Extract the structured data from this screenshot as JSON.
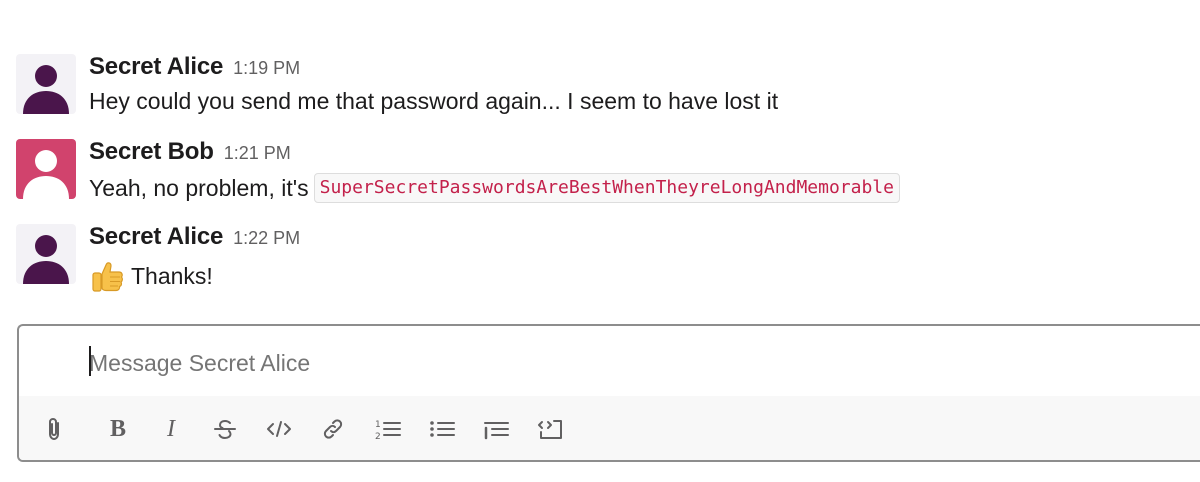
{
  "messages": [
    {
      "author": "Secret Alice",
      "time": "1:19 PM",
      "text": "Hey could you send me that password again... I seem to have lost it",
      "avatar_color": "#4a154b"
    },
    {
      "author": "Secret Bob",
      "time": "1:21 PM",
      "text": "Yeah, no problem, it's",
      "code": "SuperSecretPasswordsAreBestWhenTheyreLongAndMemorable",
      "avatar_color": "#d1436d"
    },
    {
      "author": "Secret Alice",
      "time": "1:22 PM",
      "text": "Thanks!",
      "emoji": "thumbs-up",
      "avatar_color": "#4a154b"
    }
  ],
  "composer": {
    "placeholder": "Message Secret Alice",
    "toolbar": {
      "attach_icon": "paperclip-icon",
      "bold_label": "B",
      "italic_label": "I",
      "strike_icon": "strikethrough-icon",
      "code_icon": "code-icon",
      "link_icon": "link-icon",
      "ordered_list_icon": "ordered-list-icon",
      "bulleted_list_icon": "bulleted-list-icon",
      "blockquote_icon": "blockquote-icon",
      "code_block_icon": "code-block-icon"
    }
  },
  "colors": {
    "code_text": "#c3214b",
    "alice_avatar_bg": "#f3f2f6",
    "bob_avatar_bg": "#d1436d"
  }
}
